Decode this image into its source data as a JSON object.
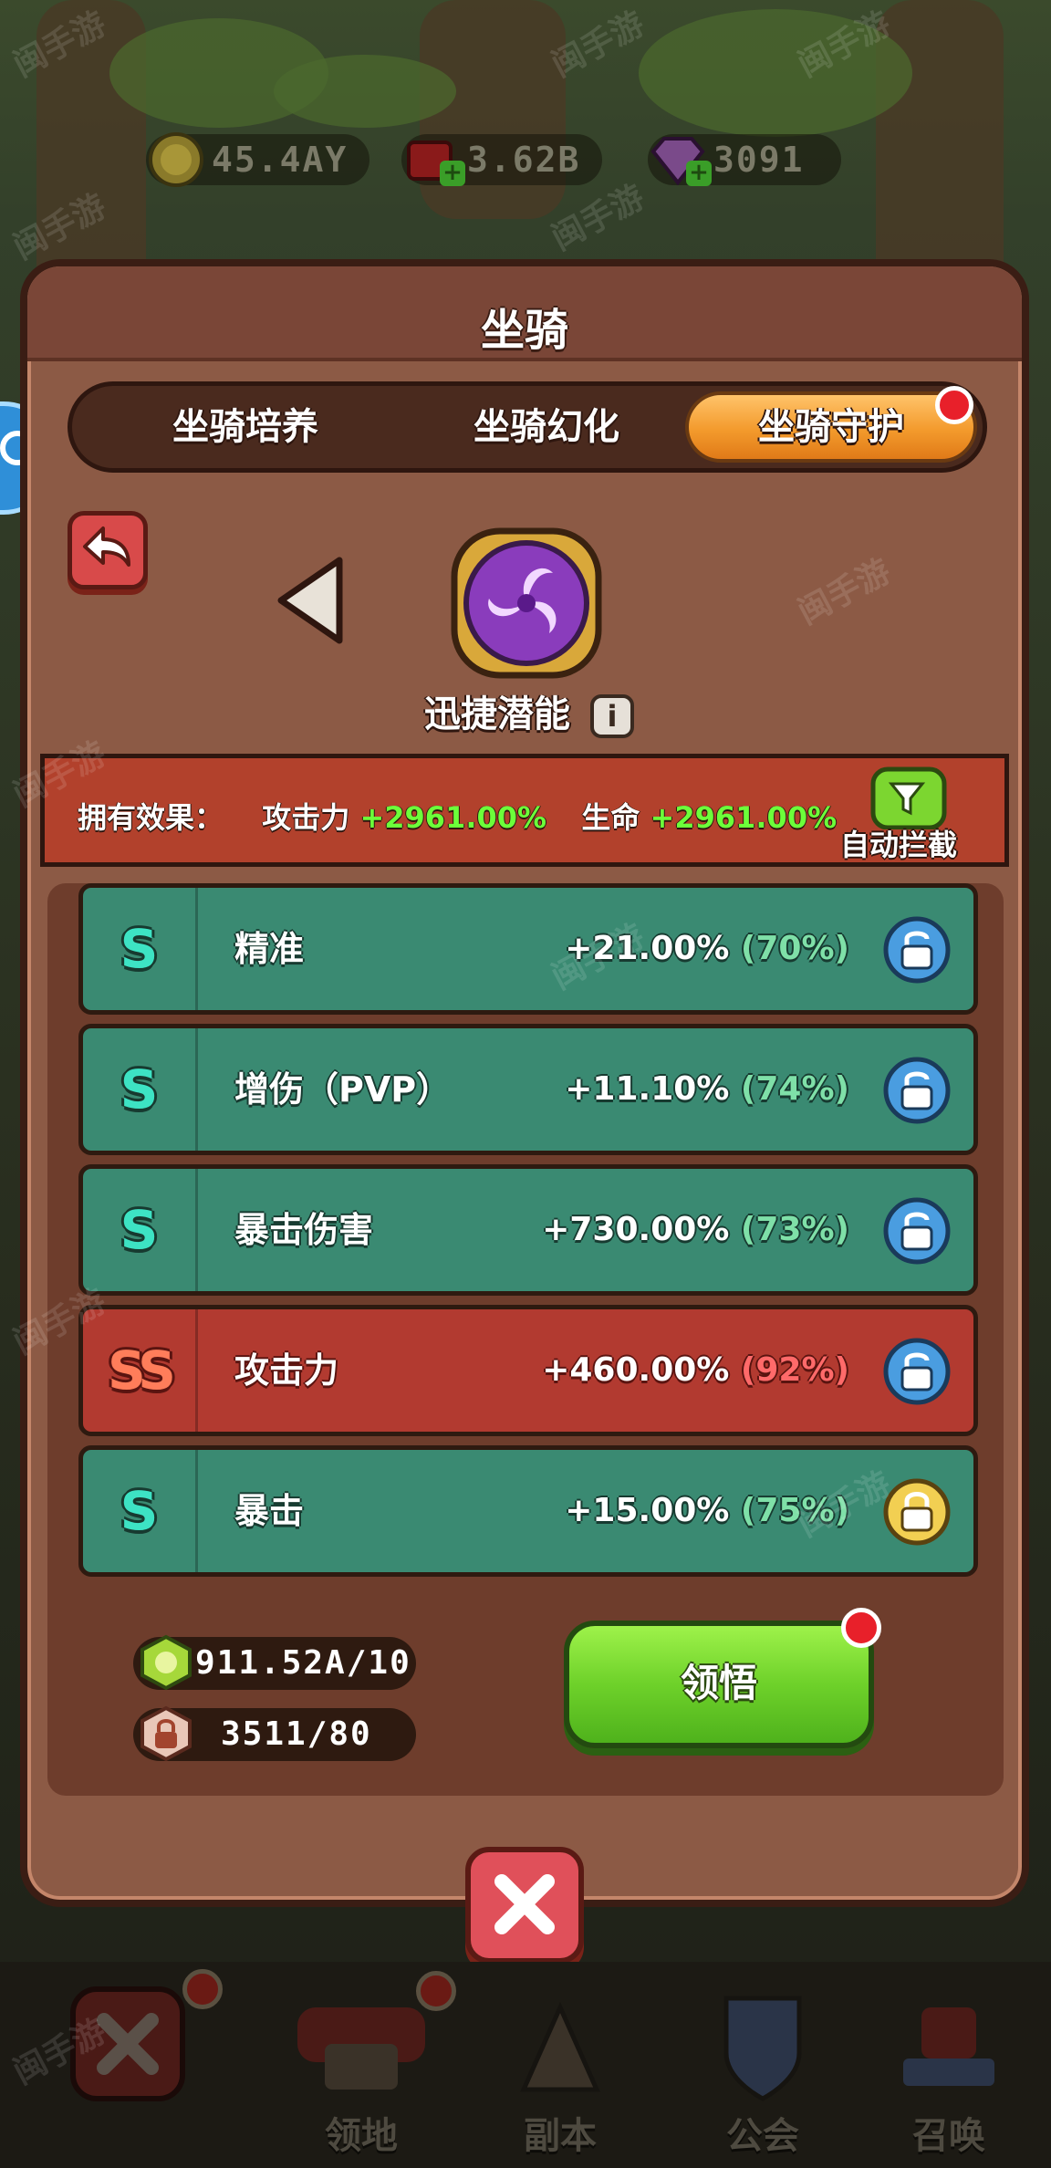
{
  "resources": [
    {
      "name": "gold",
      "value": "45.4AY"
    },
    {
      "name": "ruby",
      "value": "3.62B"
    },
    {
      "name": "diamond",
      "value": "3091"
    }
  ],
  "modal": {
    "title": "坐骑",
    "tabs": [
      {
        "label": "坐骑培养",
        "active": false
      },
      {
        "label": "坐骑幻化",
        "active": false
      },
      {
        "label": "坐骑守护",
        "active": true
      }
    ],
    "guardian_name": "迅捷潜能",
    "effects": {
      "label": "拥有效果：",
      "attack_label": "攻击力",
      "attack_value": "+2961.00%",
      "life_label": "生命",
      "life_value": "+2961.00%"
    },
    "auto_intercept_label": "自动拦截",
    "attributes": [
      {
        "grade": "S",
        "name": "精准",
        "value": "+21.00%",
        "percent": "(70%)",
        "tier": "teal",
        "locked": false
      },
      {
        "grade": "S",
        "name": "增伤（PVP）",
        "value": "+11.10%",
        "percent": "(74%)",
        "tier": "teal",
        "locked": false
      },
      {
        "grade": "S",
        "name": "暴击伤害",
        "value": "+730.00%",
        "percent": "(73%)",
        "tier": "teal",
        "locked": false
      },
      {
        "grade": "SS",
        "name": "攻击力",
        "value": "+460.00%",
        "percent": "(92%)",
        "tier": "red",
        "locked": false
      },
      {
        "grade": "S",
        "name": "暴击",
        "value": "+15.00%",
        "percent": "(75%)",
        "tier": "teal",
        "locked": true
      }
    ],
    "counters": {
      "essence": "911.52A/10",
      "lock_tokens": "3511/80"
    },
    "study_button_label": "领悟"
  },
  "bottom_nav": [
    {
      "label": "领地"
    },
    {
      "label": "副本"
    },
    {
      "label": "公会"
    },
    {
      "label": "召唤"
    }
  ],
  "watermark_text": "闽手游",
  "colors": {
    "panel_brown": "#8c5a45",
    "row_teal": "#3a8a72",
    "row_red": "#b23a30",
    "tab_active": "#f39a2c",
    "effect_green": "#6cff3a",
    "study_green": "#6ed12a"
  }
}
